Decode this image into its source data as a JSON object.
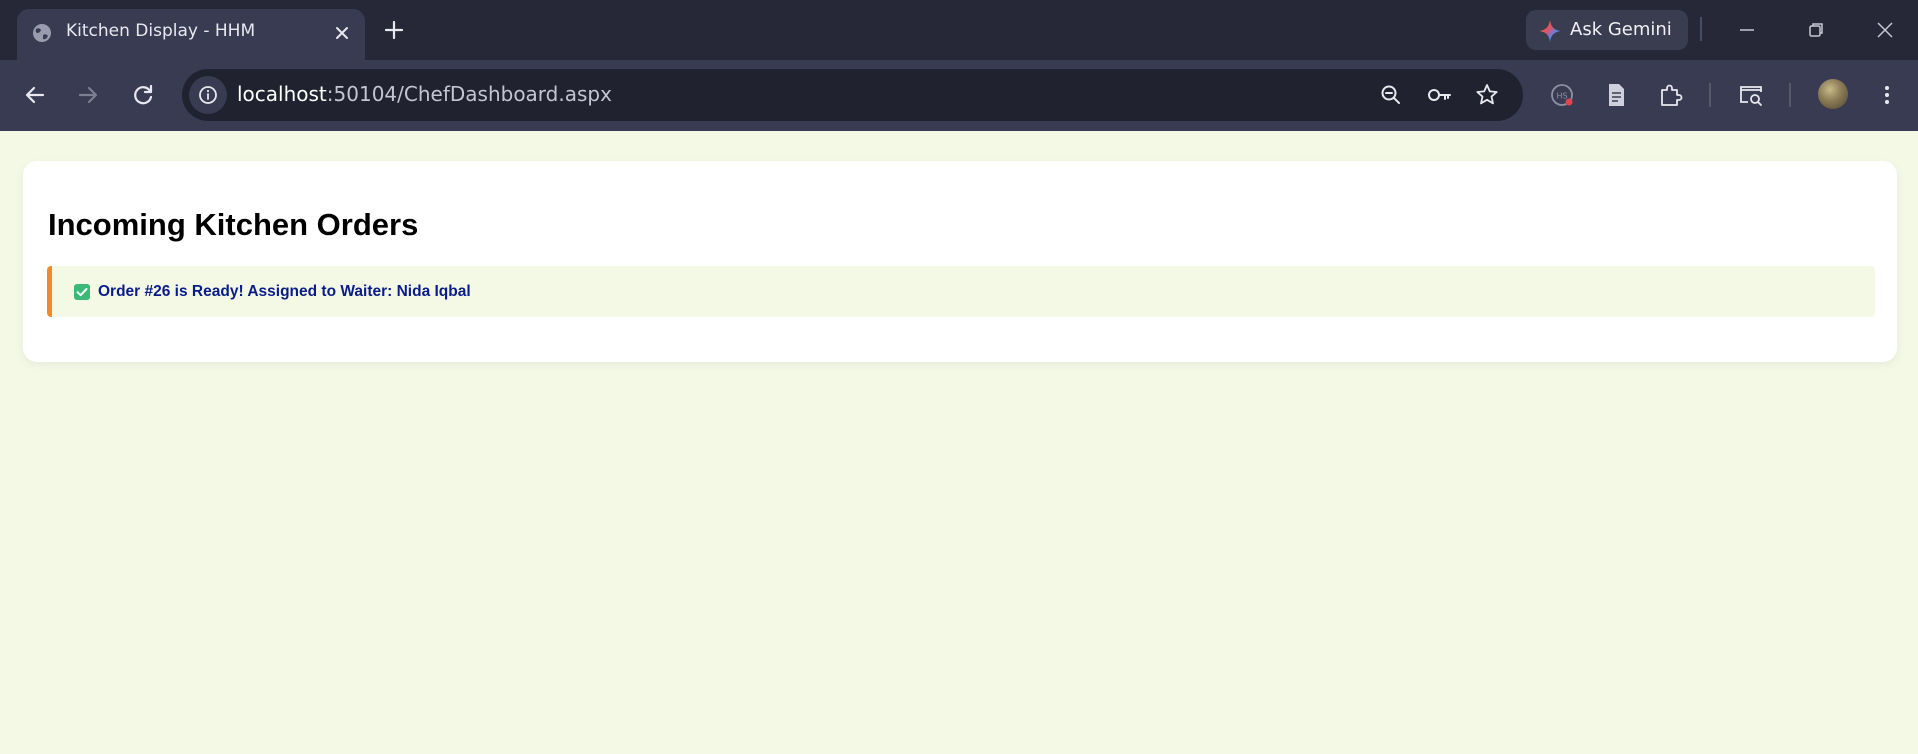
{
  "browser": {
    "tab": {
      "title": "Kitchen Display - HHM"
    },
    "gemini": {
      "label": "Ask Gemini"
    },
    "omnibox": {
      "host": "localhost",
      "path": ":50104/ChefDashboard.aspx"
    },
    "icons": {
      "favicon": "globe-icon",
      "close": "close-icon",
      "new_tab": "plus-icon",
      "back": "arrow-left-icon",
      "forward": "arrow-right-icon",
      "reload": "reload-icon",
      "site_info": "info-icon",
      "zoom": "zoom-out-icon",
      "passwords": "key-icon",
      "bookmark": "star-icon",
      "extension_a": "extension-badge-icon",
      "document": "document-icon",
      "extensions": "puzzle-icon",
      "tab_search": "tab-search-icon",
      "menu": "kebab-menu-icon",
      "minimize": "minimize-icon",
      "restore": "restore-icon",
      "window_close": "close-icon"
    }
  },
  "page": {
    "title": "Incoming Kitchen Orders",
    "notice": {
      "icon": "check-box-icon",
      "text": "Order #26 is Ready! Assigned to Waiter: Nida Iqbal",
      "accent_color": "#f28a2b",
      "text_color": "#0a1c8a"
    },
    "background_color": "#f4f9e6"
  }
}
